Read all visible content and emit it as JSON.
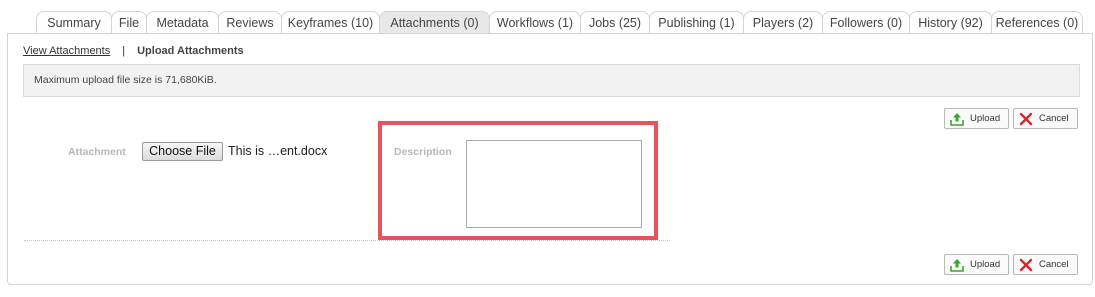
{
  "tabs": [
    {
      "label": "Summary"
    },
    {
      "label": "File"
    },
    {
      "label": "Metadata"
    },
    {
      "label": "Reviews"
    },
    {
      "label": "Keyframes (10)"
    },
    {
      "label": "Attachments (0)"
    },
    {
      "label": "Workflows (1)"
    },
    {
      "label": "Jobs (25)"
    },
    {
      "label": "Publishing (1)"
    },
    {
      "label": "Players (2)"
    },
    {
      "label": "Followers (0)"
    },
    {
      "label": "History (92)"
    },
    {
      "label": "References (0)"
    }
  ],
  "active_tab": "Attachments (0)",
  "subnav": {
    "view_link": "View Attachments",
    "separator": "|",
    "current": "Upload Attachments"
  },
  "info_message": "Maximum upload file size is 71,680KiB.",
  "buttons": {
    "upload": "Upload",
    "cancel": "Cancel",
    "upload_icon": "upload-arrow-icon",
    "cancel_icon": "red-x-icon"
  },
  "form": {
    "attachment_label": "Attachment",
    "choose_file_label": "Choose File",
    "selected_file": "This is …ent.docx",
    "description_label": "Description",
    "description_value": ""
  },
  "colors": {
    "highlight": "#e8515e",
    "upload_icon": "#3aa532",
    "cancel_icon": "#d9262c"
  }
}
